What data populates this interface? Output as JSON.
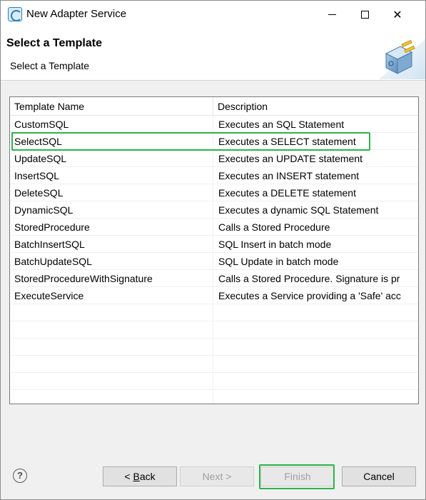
{
  "window": {
    "title": "New Adapter Service"
  },
  "banner": {
    "title": "Select a Template",
    "description": "Select a Template"
  },
  "table": {
    "columns": [
      "Template Name",
      "Description"
    ],
    "rows": [
      {
        "name": "CustomSQL",
        "description": "Executes an SQL Statement"
      },
      {
        "name": "SelectSQL",
        "description": "Executes a SELECT statement"
      },
      {
        "name": "UpdateSQL",
        "description": "Executes an UPDATE statement"
      },
      {
        "name": "InsertSQL",
        "description": "Executes an INSERT statement"
      },
      {
        "name": "DeleteSQL",
        "description": "Executes a DELETE statement"
      },
      {
        "name": "DynamicSQL",
        "description": "Executes a dynamic SQL Statement"
      },
      {
        "name": "StoredProcedure",
        "description": "Calls a Stored Procedure"
      },
      {
        "name": "BatchInsertSQL",
        "description": "SQL Insert in batch mode"
      },
      {
        "name": "BatchUpdateSQL",
        "description": "SQL Update in batch mode"
      },
      {
        "name": "StoredProcedureWithSignature",
        "description": "Calls a Stored Procedure. Signature is pr"
      },
      {
        "name": "ExecuteService",
        "description": "Executes a Service providing a 'Safe' acc"
      }
    ],
    "empty_rows": 6,
    "highlighted_row": "SelectSQL"
  },
  "buttons": {
    "help": "?",
    "back_prefix": "< ",
    "back_mnemonic": "B",
    "back_rest": "ack",
    "next": "Next >",
    "finish": "Finish",
    "cancel": "Cancel"
  },
  "colors": {
    "highlight": "#2fb24a",
    "disabled_text": "#a0a0a0"
  }
}
